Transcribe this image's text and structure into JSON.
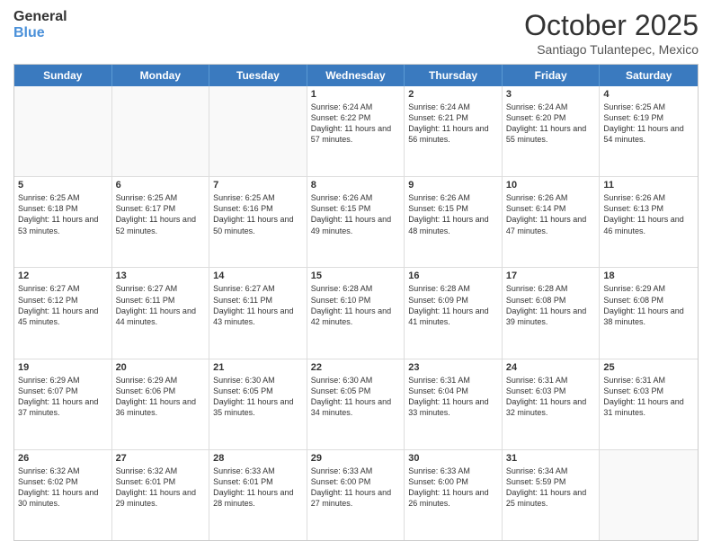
{
  "header": {
    "logo_line1": "General",
    "logo_line2": "Blue",
    "month": "October 2025",
    "location": "Santiago Tulantepec, Mexico"
  },
  "days_of_week": [
    "Sunday",
    "Monday",
    "Tuesday",
    "Wednesday",
    "Thursday",
    "Friday",
    "Saturday"
  ],
  "weeks": [
    [
      {
        "num": "",
        "text": ""
      },
      {
        "num": "",
        "text": ""
      },
      {
        "num": "",
        "text": ""
      },
      {
        "num": "1",
        "text": "Sunrise: 6:24 AM\nSunset: 6:22 PM\nDaylight: 11 hours and 57 minutes."
      },
      {
        "num": "2",
        "text": "Sunrise: 6:24 AM\nSunset: 6:21 PM\nDaylight: 11 hours and 56 minutes."
      },
      {
        "num": "3",
        "text": "Sunrise: 6:24 AM\nSunset: 6:20 PM\nDaylight: 11 hours and 55 minutes."
      },
      {
        "num": "4",
        "text": "Sunrise: 6:25 AM\nSunset: 6:19 PM\nDaylight: 11 hours and 54 minutes."
      }
    ],
    [
      {
        "num": "5",
        "text": "Sunrise: 6:25 AM\nSunset: 6:18 PM\nDaylight: 11 hours and 53 minutes."
      },
      {
        "num": "6",
        "text": "Sunrise: 6:25 AM\nSunset: 6:17 PM\nDaylight: 11 hours and 52 minutes."
      },
      {
        "num": "7",
        "text": "Sunrise: 6:25 AM\nSunset: 6:16 PM\nDaylight: 11 hours and 50 minutes."
      },
      {
        "num": "8",
        "text": "Sunrise: 6:26 AM\nSunset: 6:15 PM\nDaylight: 11 hours and 49 minutes."
      },
      {
        "num": "9",
        "text": "Sunrise: 6:26 AM\nSunset: 6:15 PM\nDaylight: 11 hours and 48 minutes."
      },
      {
        "num": "10",
        "text": "Sunrise: 6:26 AM\nSunset: 6:14 PM\nDaylight: 11 hours and 47 minutes."
      },
      {
        "num": "11",
        "text": "Sunrise: 6:26 AM\nSunset: 6:13 PM\nDaylight: 11 hours and 46 minutes."
      }
    ],
    [
      {
        "num": "12",
        "text": "Sunrise: 6:27 AM\nSunset: 6:12 PM\nDaylight: 11 hours and 45 minutes."
      },
      {
        "num": "13",
        "text": "Sunrise: 6:27 AM\nSunset: 6:11 PM\nDaylight: 11 hours and 44 minutes."
      },
      {
        "num": "14",
        "text": "Sunrise: 6:27 AM\nSunset: 6:11 PM\nDaylight: 11 hours and 43 minutes."
      },
      {
        "num": "15",
        "text": "Sunrise: 6:28 AM\nSunset: 6:10 PM\nDaylight: 11 hours and 42 minutes."
      },
      {
        "num": "16",
        "text": "Sunrise: 6:28 AM\nSunset: 6:09 PM\nDaylight: 11 hours and 41 minutes."
      },
      {
        "num": "17",
        "text": "Sunrise: 6:28 AM\nSunset: 6:08 PM\nDaylight: 11 hours and 39 minutes."
      },
      {
        "num": "18",
        "text": "Sunrise: 6:29 AM\nSunset: 6:08 PM\nDaylight: 11 hours and 38 minutes."
      }
    ],
    [
      {
        "num": "19",
        "text": "Sunrise: 6:29 AM\nSunset: 6:07 PM\nDaylight: 11 hours and 37 minutes."
      },
      {
        "num": "20",
        "text": "Sunrise: 6:29 AM\nSunset: 6:06 PM\nDaylight: 11 hours and 36 minutes."
      },
      {
        "num": "21",
        "text": "Sunrise: 6:30 AM\nSunset: 6:05 PM\nDaylight: 11 hours and 35 minutes."
      },
      {
        "num": "22",
        "text": "Sunrise: 6:30 AM\nSunset: 6:05 PM\nDaylight: 11 hours and 34 minutes."
      },
      {
        "num": "23",
        "text": "Sunrise: 6:31 AM\nSunset: 6:04 PM\nDaylight: 11 hours and 33 minutes."
      },
      {
        "num": "24",
        "text": "Sunrise: 6:31 AM\nSunset: 6:03 PM\nDaylight: 11 hours and 32 minutes."
      },
      {
        "num": "25",
        "text": "Sunrise: 6:31 AM\nSunset: 6:03 PM\nDaylight: 11 hours and 31 minutes."
      }
    ],
    [
      {
        "num": "26",
        "text": "Sunrise: 6:32 AM\nSunset: 6:02 PM\nDaylight: 11 hours and 30 minutes."
      },
      {
        "num": "27",
        "text": "Sunrise: 6:32 AM\nSunset: 6:01 PM\nDaylight: 11 hours and 29 minutes."
      },
      {
        "num": "28",
        "text": "Sunrise: 6:33 AM\nSunset: 6:01 PM\nDaylight: 11 hours and 28 minutes."
      },
      {
        "num": "29",
        "text": "Sunrise: 6:33 AM\nSunset: 6:00 PM\nDaylight: 11 hours and 27 minutes."
      },
      {
        "num": "30",
        "text": "Sunrise: 6:33 AM\nSunset: 6:00 PM\nDaylight: 11 hours and 26 minutes."
      },
      {
        "num": "31",
        "text": "Sunrise: 6:34 AM\nSunset: 5:59 PM\nDaylight: 11 hours and 25 minutes."
      },
      {
        "num": "",
        "text": ""
      }
    ]
  ]
}
